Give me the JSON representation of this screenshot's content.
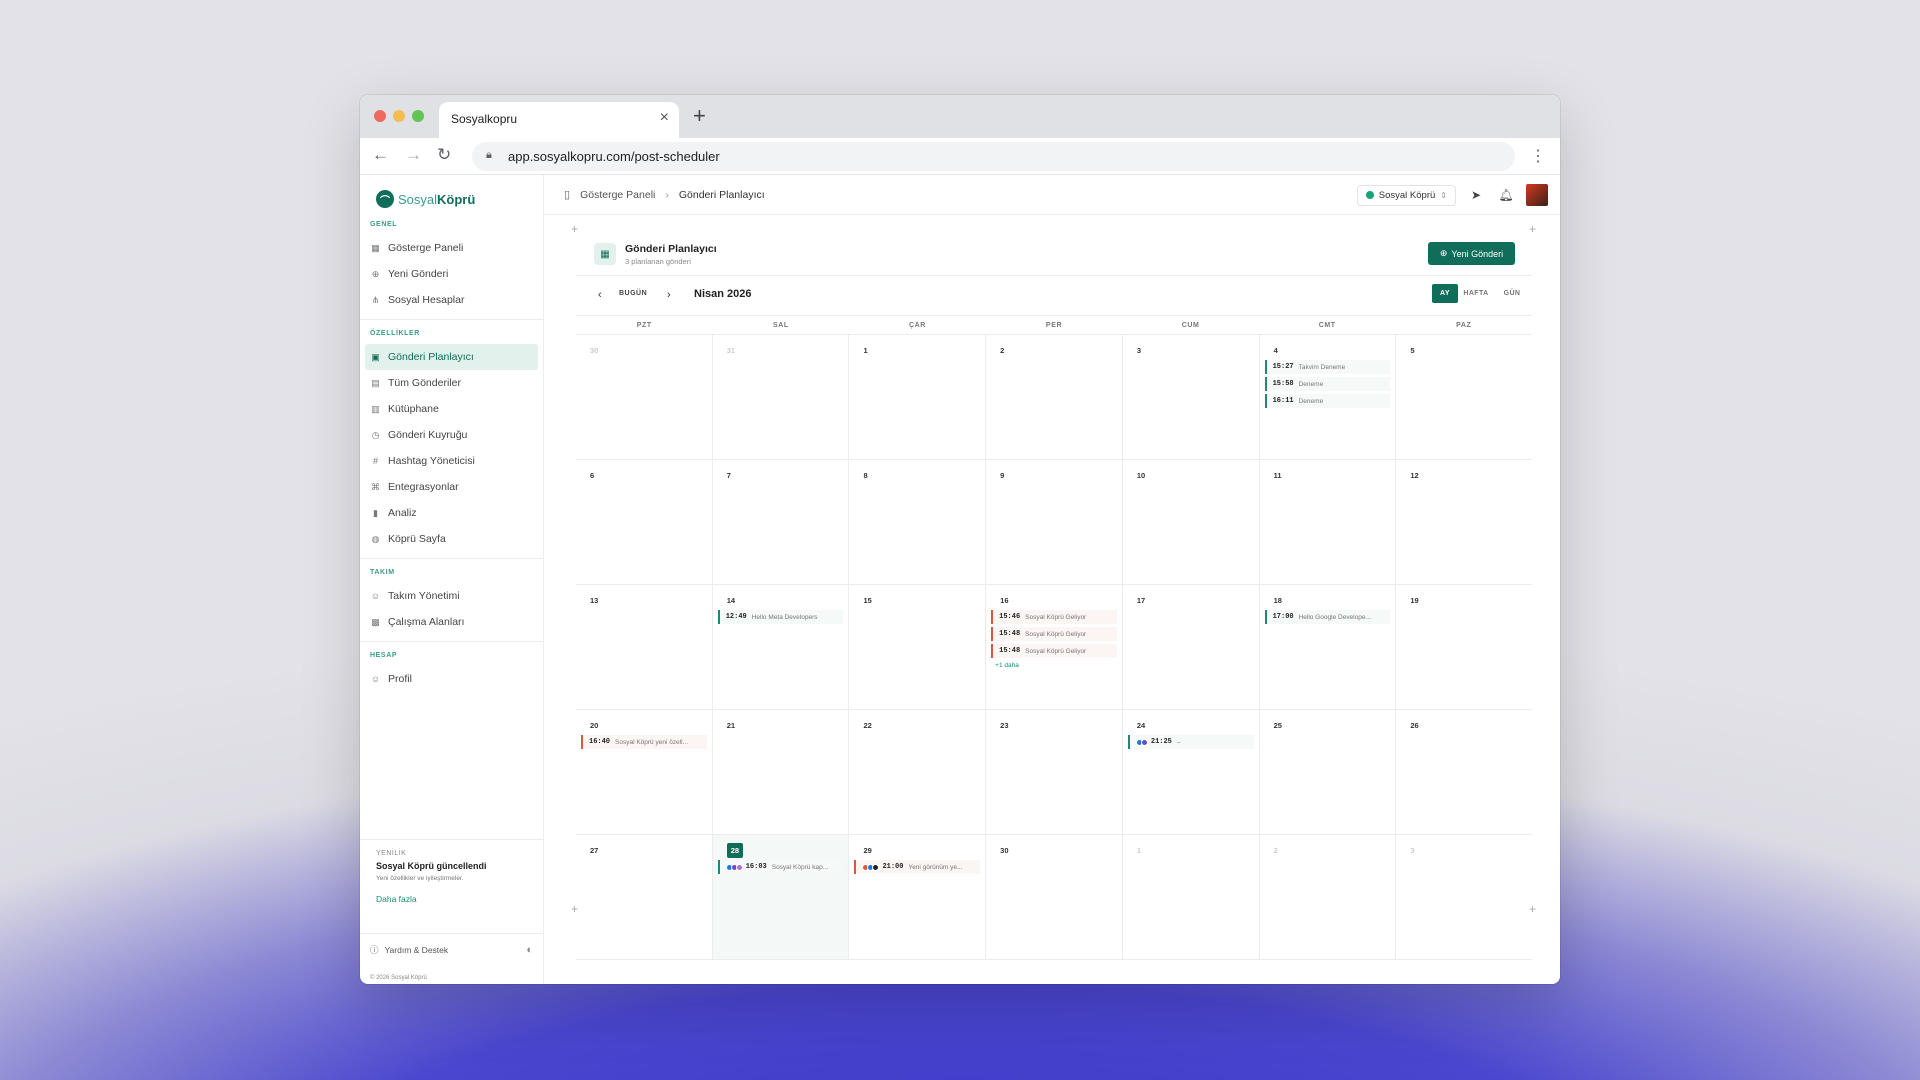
{
  "browser": {
    "tab_title": "Sosyalkopru",
    "url": "app.sosyalkopru.com/post-scheduler"
  },
  "brand": {
    "name_light": "Sosyal",
    "name_bold": "Köprü"
  },
  "sidebar": {
    "sections": [
      {
        "title": "GENEL",
        "items": [
          {
            "label": "Gösterge Paneli",
            "icon": "grid-icon"
          },
          {
            "label": "Yeni Gönderi",
            "icon": "plus-circle-icon"
          },
          {
            "label": "Sosyal Hesaplar",
            "icon": "share-icon"
          }
        ]
      },
      {
        "title": "ÖZELLİKLER",
        "items": [
          {
            "label": "Gönderi Planlayıcı",
            "icon": "calendar-icon",
            "active": true
          },
          {
            "label": "Tüm Gönderiler",
            "icon": "document-icon"
          },
          {
            "label": "Kütüphane",
            "icon": "library-icon"
          },
          {
            "label": "Gönderi Kuyruğu",
            "icon": "queue-icon"
          },
          {
            "label": "Hashtag Yöneticisi",
            "icon": "hash-icon"
          },
          {
            "label": "Entegrasyonlar",
            "icon": "plug-icon"
          },
          {
            "label": "Analiz",
            "icon": "bar-chart-icon"
          },
          {
            "label": "Köprü Sayfa",
            "icon": "globe-icon"
          }
        ]
      },
      {
        "title": "TAKIM",
        "items": [
          {
            "label": "Takım Yönetimi",
            "icon": "users-icon"
          },
          {
            "label": "Çalışma Alanları",
            "icon": "building-icon"
          }
        ]
      },
      {
        "title": "HESAP",
        "items": [
          {
            "label": "Profil",
            "icon": "user-icon"
          }
        ]
      }
    ],
    "news": {
      "kicker": "YENİLİK",
      "title": "Sosyal Köprü güncellendi",
      "desc": "Yeni özellikler ve iyileştirmeler.",
      "link": "Daha fazla"
    },
    "help": "Yardım & Destek",
    "copyright": "© 2026 Sosyal Köprü"
  },
  "header": {
    "breadcrumb_parent": "Gösterge Paneli",
    "breadcrumb_current": "Gönderi Planlayıcı",
    "account": "Sosyal Köprü"
  },
  "scheduler": {
    "title": "Gönderi Planlayıcı",
    "subtitle": "3 planlanan gönderi",
    "new_button": "Yeni Gönderi",
    "today_label": "BUGÜN",
    "month_label": "Nisan 2026",
    "views": [
      "AY",
      "HAFTA",
      "GÜN"
    ],
    "active_view": "AY",
    "weekdays": [
      "PZT",
      "SAL",
      "ÇAR",
      "PER",
      "CUM",
      "CMT",
      "PAZ"
    ],
    "weeks": [
      [
        {
          "day": "30",
          "other": true
        },
        {
          "day": "31",
          "other": true
        },
        {
          "day": "1"
        },
        {
          "day": "2"
        },
        {
          "day": "3"
        },
        {
          "day": "4",
          "events": [
            {
              "time": "15:27",
              "title": "Takvim Deneme"
            },
            {
              "time": "15:58",
              "title": "Deneme"
            },
            {
              "time": "16:11",
              "title": "Deneme"
            }
          ]
        },
        {
          "day": "5"
        }
      ],
      [
        {
          "day": "6"
        },
        {
          "day": "7"
        },
        {
          "day": "8"
        },
        {
          "day": "9"
        },
        {
          "day": "10"
        },
        {
          "day": "11"
        },
        {
          "day": "12"
        }
      ],
      [
        {
          "day": "13"
        },
        {
          "day": "14",
          "events": [
            {
              "time": "12:49",
              "title": "Hello Meta Developers"
            }
          ]
        },
        {
          "day": "15"
        },
        {
          "day": "16",
          "events": [
            {
              "time": "15:46",
              "title": "Sosyal Köprü Geliyor",
              "red": true
            },
            {
              "time": "15:48",
              "title": "Sosyal Köprü Geliyor",
              "red": true
            },
            {
              "time": "15:48",
              "title": "Sosyal Köprü Geliyor",
              "red": true
            }
          ],
          "more": "+1 daha"
        },
        {
          "day": "17"
        },
        {
          "day": "18",
          "events": [
            {
              "time": "17:00",
              "title": "Hello Google Develope..."
            }
          ]
        },
        {
          "day": "19"
        }
      ],
      [
        {
          "day": "20",
          "events": [
            {
              "time": "16:40",
              "title": "Sosyal Köprü yeni özell...",
              "red": true
            }
          ]
        },
        {
          "day": "21"
        },
        {
          "day": "22"
        },
        {
          "day": "23"
        },
        {
          "day": "24",
          "events": [
            {
              "time": "21:25",
              "title": "–",
              "avatars": [
                "#1877f2",
                "#6a4bc4"
              ]
            }
          ]
        },
        {
          "day": "25"
        },
        {
          "day": "26"
        }
      ],
      [
        {
          "day": "27"
        },
        {
          "day": "28",
          "today": true,
          "events": [
            {
              "time": "16:03",
              "title": "Sosyal Köprü kap...",
              "avatars": [
                "#1877f2",
                "#6a4bc4",
                "#b46bd6"
              ]
            }
          ]
        },
        {
          "day": "29",
          "events": [
            {
              "time": "21:00",
              "title": "Yeni görünüm ye...",
              "red": true,
              "avatars": [
                "#d9573a",
                "#1877f2",
                "#222222"
              ]
            }
          ]
        },
        {
          "day": "30"
        },
        {
          "day": "1",
          "other": true
        },
        {
          "day": "2",
          "other": true
        },
        {
          "day": "3",
          "other": true
        }
      ]
    ]
  },
  "colors": {
    "accent": "#0f6d5a",
    "accent_light": "#e3f1ed",
    "event_red": "#d9573a"
  }
}
